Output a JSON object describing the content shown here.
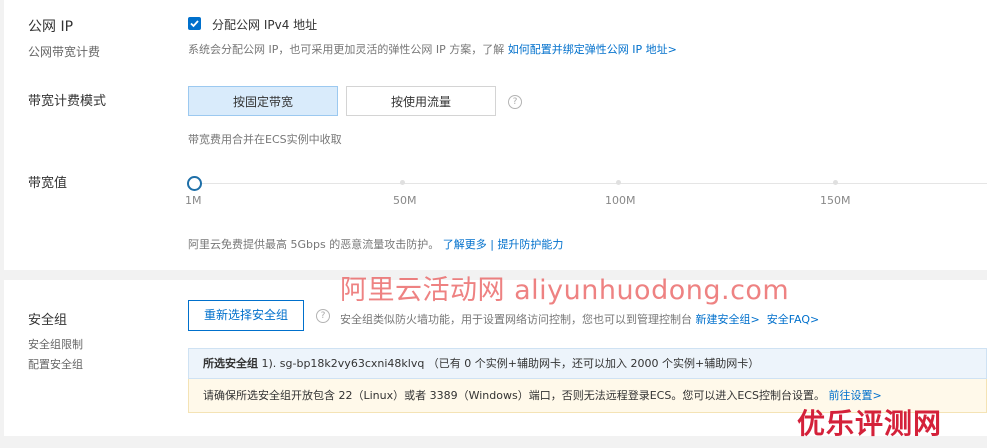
{
  "public_ip": {
    "label": "公网 IP",
    "sublabel": "公网带宽计费",
    "checkbox_label": "分配公网 IPv4 地址",
    "checked": true,
    "description": "系统会分配公网 IP，也可采用更加灵活的弹性公网 IP 方案，了解",
    "link": "如何配置并绑定弹性公网 IP 地址>"
  },
  "billing_mode": {
    "label": "带宽计费模式",
    "options": [
      "按固定带宽",
      "按使用流量"
    ],
    "selected": "按固定带宽",
    "help_icon": "question-circle-icon",
    "description": "带宽费用合并在ECS实例中收取"
  },
  "bandwidth": {
    "label": "带宽值",
    "ticks": [
      "1M",
      "50M",
      "100M",
      "150M"
    ],
    "value": "1M",
    "description": "阿里云免费提供最高 5Gbps 的恶意流量攻击防护。",
    "link_more": "了解更多",
    "separator": "|",
    "link_upgrade": "提升防护能力"
  },
  "security_group": {
    "label": "安全组",
    "sublabel_1": "安全组限制",
    "sublabel_2": "配置安全组",
    "reselect_button": "重新选择安全组",
    "help_icon": "question-circle-icon",
    "description": "安全组类似防火墙功能，用于设置网络访问控制，您也可以到管理控制台",
    "link_new": "新建安全组>",
    "link_faq": "安全FAQ>",
    "selected_title": "所选安全组",
    "selected_detail": "1). sg-bp18k2vy63cxni48klvq （已有 0 个实例+辅助网卡，还可以加入 2000 个实例+辅助网卡）",
    "warning_text": "请确保所选安全组开放包含 22（Linux）或者 3389（Windows）端口，否则无法远程登录ECS。您可以进入ECS控制台设置。",
    "warning_link": "前往设置>"
  },
  "watermark": "阿里云活动网 aliyunhuodong.com",
  "badge": "优乐评测网",
  "colors": {
    "accent": "#0070cc",
    "selected_bg": "#d9ebfb",
    "warning_bg": "#fff9ea",
    "watermark": "#e85858",
    "badge": "#d4213a"
  }
}
